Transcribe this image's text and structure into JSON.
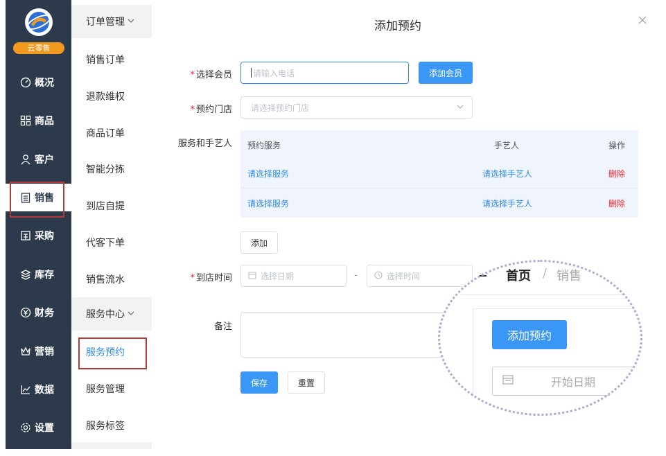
{
  "brand": {
    "badge": "云零售"
  },
  "nav": {
    "items": [
      {
        "label": "概况",
        "icon": "dashboard-icon"
      },
      {
        "label": "商品",
        "icon": "grid-icon"
      },
      {
        "label": "客户",
        "icon": "user-icon"
      },
      {
        "label": "销售",
        "icon": "clipboard-icon",
        "active": true
      },
      {
        "label": "采购",
        "icon": "cart-icon"
      },
      {
        "label": "库存",
        "icon": "stack-icon"
      },
      {
        "label": "财务",
        "icon": "yen-icon"
      },
      {
        "label": "营销",
        "icon": "crown-icon"
      },
      {
        "label": "数据",
        "icon": "line-chart-icon"
      },
      {
        "label": "设置",
        "icon": "gear-icon"
      }
    ]
  },
  "submenu": {
    "group1": "订单管理",
    "group1_items": [
      "销售订单",
      "退款维权",
      "商品订单",
      "智能分拣",
      "到店自提",
      "代客下单",
      "销售流水"
    ],
    "group2": "服务中心",
    "group2_items": [
      "服务预约",
      "服务管理",
      "服务标签"
    ]
  },
  "dialog": {
    "title": "添加预约",
    "member_label": "选择会员",
    "member_placeholder": "请输入电话",
    "add_member_btn": "添加会员",
    "store_label": "预约门店",
    "store_placeholder": "请选择预约门店",
    "services_label": "服务和手艺人",
    "table": {
      "headers": {
        "service": "预约服务",
        "artisan": "手艺人",
        "action": "操作"
      },
      "rows": [
        {
          "service": "请选择服务",
          "artisan": "请选择手艺人",
          "action": "删除"
        },
        {
          "service": "请选择服务",
          "artisan": "请选择手艺人",
          "action": "删除"
        }
      ]
    },
    "add_row_btn": "添加",
    "time_label": "到店时间",
    "date_placeholder": "选择日期",
    "range_sep": "-",
    "time_placeholder": "选择时间",
    "remark_label": "备注",
    "save_btn": "保存",
    "reset_btn": "重置"
  },
  "zoom": {
    "breadcrumb_home": "首页",
    "breadcrumb_sep": "/",
    "breadcrumb_current": "销售",
    "button": "添加预约",
    "start_date": "开始日期"
  },
  "colors": {
    "sidebar": "#2d3a4b",
    "primary": "#3b97f5",
    "danger": "#f5222d",
    "highlight": "#b43a3a",
    "badge": "#f39a1e"
  }
}
